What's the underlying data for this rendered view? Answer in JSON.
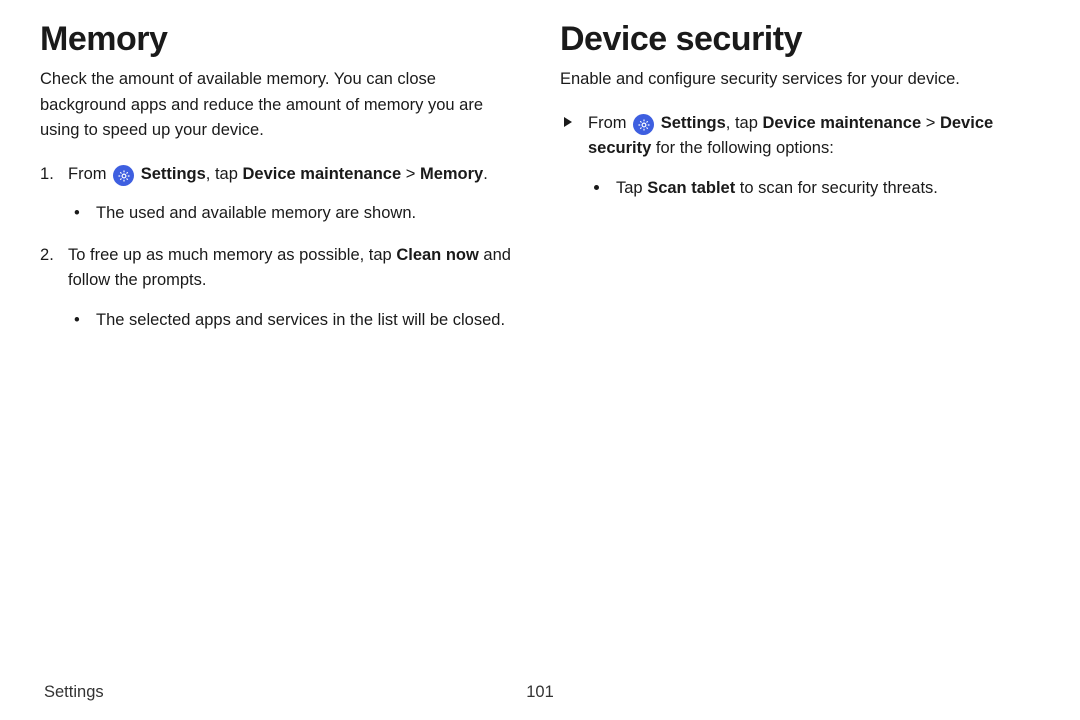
{
  "left": {
    "heading": "Memory",
    "intro": "Check the amount of available memory. You can close background apps and reduce the amount of memory you are using to speed up your device.",
    "step1_pre": "From ",
    "step1_settings": "Settings",
    "step1_mid": ", tap ",
    "step1_dm": "Device maintenance",
    "step1_gt": " > ",
    "step1_memory": "Memory",
    "step1_end": ".",
    "step1_sub": "The used and available memory are shown.",
    "step2_pre": "To free up as much memory as possible, tap ",
    "step2_clean": "Clean now",
    "step2_post": " and follow the prompts.",
    "step2_sub": "The selected apps and services in the list will be closed."
  },
  "right": {
    "heading": "Device security",
    "intro": "Enable and configure security services for your device.",
    "b1_pre": "From ",
    "b1_settings": "Settings",
    "b1_mid": ", tap ",
    "b1_dm": "Device maintenance",
    "b1_gt": " > ",
    "b1_ds": "Device security",
    "b1_post": " for the following options:",
    "b1_sub_pre": "Tap ",
    "b1_sub_scan": "Scan tablet",
    "b1_sub_post": " to scan for security threats."
  },
  "footer": {
    "section": "Settings",
    "page": "101"
  },
  "icons": {
    "gear": "gear-icon"
  }
}
